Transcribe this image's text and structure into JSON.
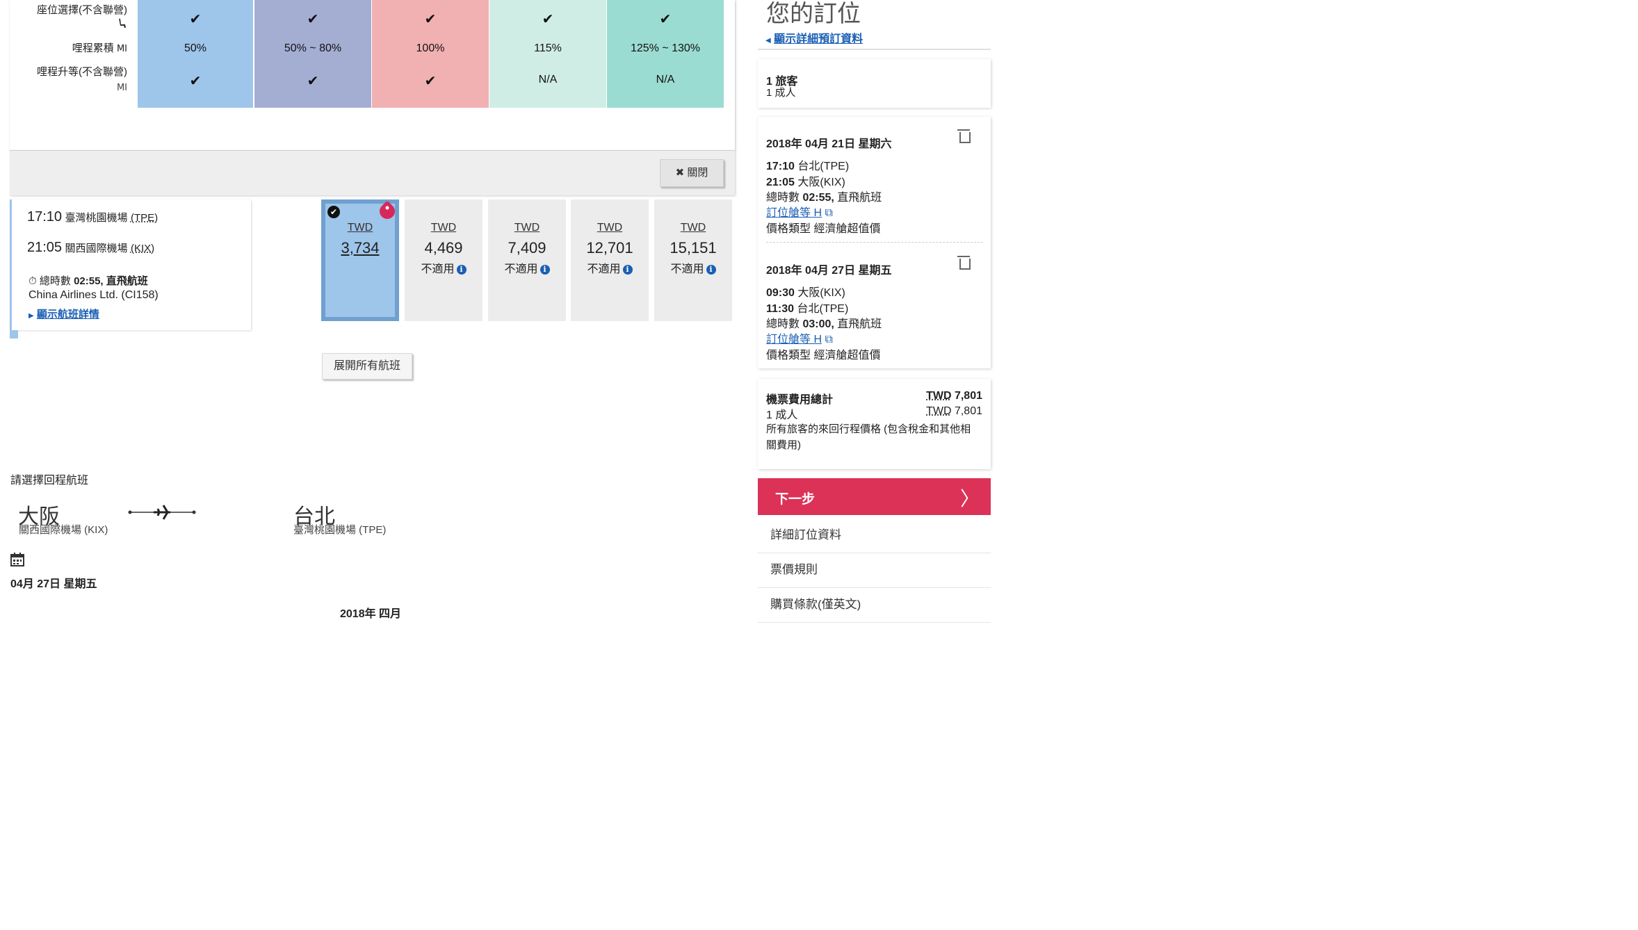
{
  "fare_table": {
    "rows": [
      {
        "label": "座位選擇(不含聯營)",
        "icon": "seat-icon"
      },
      {
        "label": "哩程累積",
        "icon": "miles-icon"
      },
      {
        "label": "哩程升等(不含聯營)",
        "icon": "miles-icon"
      }
    ],
    "columns": [
      {
        "color": "#9ec5ea",
        "seat": "✔",
        "miles": "50%",
        "upgrade": "✔"
      },
      {
        "color": "#a4aed3",
        "seat": "✔",
        "miles": "50% ~ 80%",
        "upgrade": "✔"
      },
      {
        "color": "#f1b0b2",
        "seat": "✔",
        "miles": "100%",
        "upgrade": "✔"
      },
      {
        "color": "#cfede4",
        "seat": "✔",
        "miles": "115%",
        "upgrade": "N/A"
      },
      {
        "color": "#9bdcd2",
        "seat": "✔",
        "miles": "125% ~ 130%",
        "upgrade": "N/A"
      }
    ],
    "close_label": "關閉"
  },
  "flight": {
    "dep_time": "17:10",
    "dep_airport": "臺灣桃園機場",
    "dep_code": "(TPE)",
    "arr_time": "21:05",
    "arr_airport": "關西國際機場",
    "arr_code": "(KIX)",
    "duration_prefix": "總時數",
    "duration": "02:55, 直飛航班",
    "carrier": "China Airlines Ltd. (CI158)",
    "details_link": "顯示航班詳情"
  },
  "fares": [
    {
      "currency": "TWD",
      "amount": "3,734",
      "note": "",
      "selected": true
    },
    {
      "currency": "TWD",
      "amount": "4,469",
      "note": "不適用",
      "selected": false
    },
    {
      "currency": "TWD",
      "amount": "7,409",
      "note": "不適用",
      "selected": false
    },
    {
      "currency": "TWD",
      "amount": "12,701",
      "note": "不適用",
      "selected": false
    },
    {
      "currency": "TWD",
      "amount": "15,151",
      "note": "不適用",
      "selected": false
    }
  ],
  "expand_all": "展開所有航班",
  "return": {
    "heading": "請選擇回程航班",
    "from_city": "大阪",
    "from_airport": "關西國際機場 (KIX)",
    "to_city": "台北",
    "to_airport": "臺灣桃園機場 (TPE)",
    "date": "04月 27日 星期五",
    "month_label": "2018年 四月"
  },
  "sidebar": {
    "title": "您的訂位",
    "show_details": "顯示詳細預訂資料",
    "travelers": "1 旅客",
    "travelers_detail": "1 成人",
    "outbound": {
      "date": "2018年 04月 21日 星期六",
      "dep_time": "17:10",
      "dep": "台北(TPE)",
      "arr_time": "21:05",
      "arr": "大阪(KIX)",
      "duration_prefix": "總時數",
      "duration": "02:55,",
      "duration_suffix": "直飛航班",
      "class_link": "訂位艙等 H",
      "fare_type": "價格類型 經濟艙超值價"
    },
    "inbound": {
      "date": "2018年 04月 27日 星期五",
      "dep_time": "09:30",
      "dep": "大阪(KIX)",
      "arr_time": "11:30",
      "arr": "台北(TPE)",
      "duration_prefix": "總時數",
      "duration": "03:00,",
      "duration_suffix": "直飛航班",
      "class_link": "訂位艙等 H",
      "fare_type": "價格類型 經濟艙超值價"
    },
    "total_label": "機票費用總計",
    "total_currency": "TWD",
    "total_amount": "7,801",
    "adult_label": "1 成人",
    "adult_currency": "TWD",
    "adult_amount": "7,801",
    "total_note_1": "所有旅客的來回行程價格 (包含稅金和其他相",
    "total_note_2": "關費用)",
    "next_label": "下一步",
    "links": [
      "詳細訂位資料",
      "票價規則",
      "購買條款(僅英文)"
    ]
  }
}
